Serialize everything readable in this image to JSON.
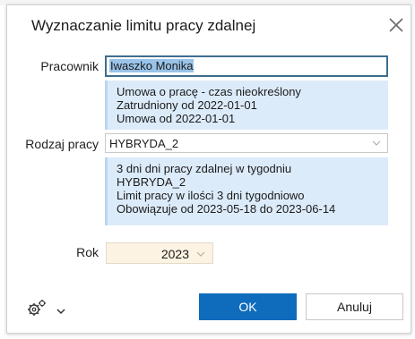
{
  "dialog": {
    "title": "Wyznaczanie limitu pracy zdalnej"
  },
  "form": {
    "employee_label": "Pracownik",
    "employee_value": "Iwaszko Monika",
    "contract_info": [
      "Umowa o pracę - czas nieokreślony",
      "Zatrudniony od 2022-01-01",
      "Umowa od 2022-01-01"
    ],
    "work_type_label": "Rodzaj pracy",
    "work_type_value": "HYBRYDA_2",
    "work_type_info": [
      "3 dni dni pracy zdalnej  w tygodniu",
      "HYBRYDA_2",
      "Limit pracy w ilości 3 dni tygodniowo",
      "Obowiązuje od 2023-05-18 do 2023-06-14"
    ],
    "year_label": "Rok",
    "year_value": "2023"
  },
  "footer": {
    "ok_label": "OK",
    "cancel_label": "Anuluj"
  },
  "colors": {
    "primary": "#0f6cbd",
    "info_bg": "#dcebfa",
    "year_bg": "#fdf3e3",
    "selection": "#99c3e8"
  },
  "icons": {
    "close": "close-icon",
    "gear": "gear-icon",
    "chevron": "chevron-down-icon"
  }
}
